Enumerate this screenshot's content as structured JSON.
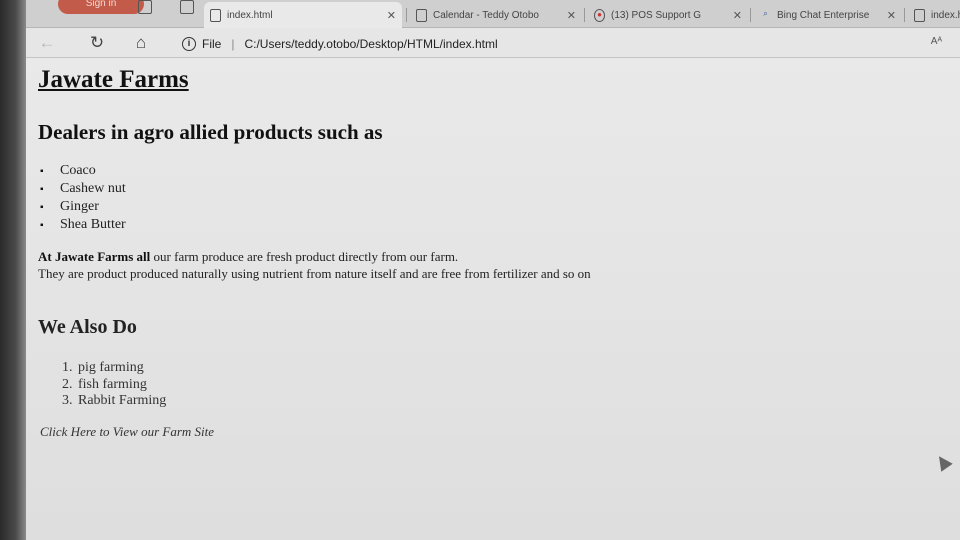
{
  "browser": {
    "signin_label": "Sign in",
    "tabs": [
      {
        "label": "index.html",
        "active": true
      },
      {
        "label": "Calendar - Teddy Otobo"
      },
      {
        "label": "(13) POS Support G"
      },
      {
        "label": "Bing Chat Enterprise"
      },
      {
        "label": "index.html"
      }
    ],
    "address": {
      "scheme": "File",
      "url": "C:/Users/teddy.otobo/Desktop/HTML/index.html"
    },
    "reader_icon": "Aᴬ"
  },
  "page": {
    "title": "Jawate Farms",
    "subheading": "Dealers in agro allied products such as",
    "products": [
      "Coaco",
      "Cashew nut",
      "Ginger",
      "Shea Butter"
    ],
    "intro_bold": "At Jawate Farms all",
    "intro_rest": " our farm produce are fresh product directly from our farm.",
    "intro_line2": "They are product produced naturally using nutrient from nature itself and are free from fertilizer and so on",
    "also_heading": "We Also Do",
    "services": [
      {
        "num": "1.",
        "label": "pig farming"
      },
      {
        "num": "2.",
        "label": "fish farming"
      },
      {
        "num": "3.",
        "label": "Rabbit Farming"
      }
    ],
    "link_text": "Click Here to View our Farm Site"
  }
}
